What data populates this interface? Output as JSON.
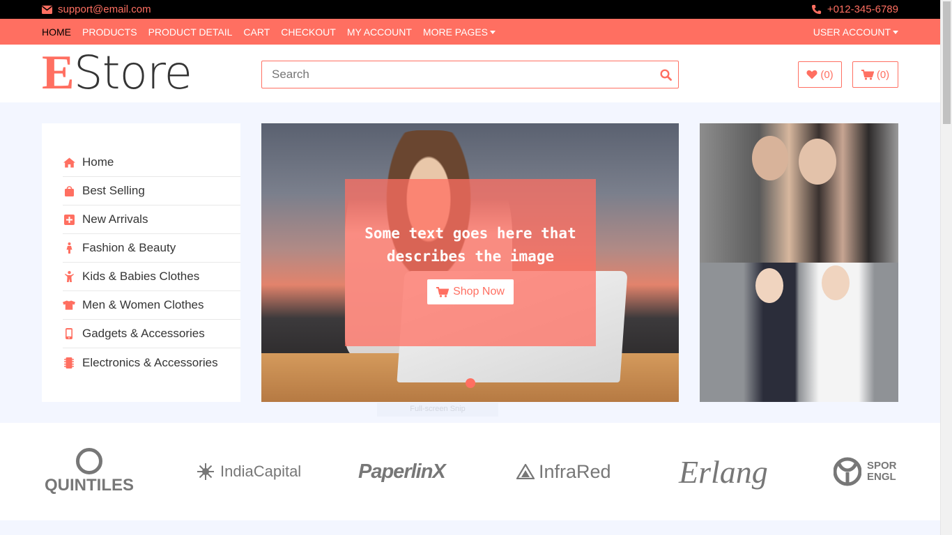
{
  "topbar": {
    "email": "support@email.com",
    "phone": "+012-345-6789"
  },
  "nav": {
    "links": [
      "HOME",
      "PRODUCTS",
      "PRODUCT DETAIL",
      "CART",
      "CHECKOUT",
      "MY ACCOUNT"
    ],
    "more": "MORE PAGES",
    "account": "USER ACCOUNT"
  },
  "header": {
    "logo_first": "E",
    "logo_rest": "Store",
    "search_placeholder": "Search",
    "wishlist_count": "(0)",
    "cart_count": "(0)"
  },
  "sidebar": {
    "items": [
      {
        "label": "Home",
        "icon": "home-icon"
      },
      {
        "label": "Best Selling",
        "icon": "shopping-bag-icon"
      },
      {
        "label": "New Arrivals",
        "icon": "plus-square-icon"
      },
      {
        "label": "Fashion & Beauty",
        "icon": "female-icon"
      },
      {
        "label": "Kids & Babies Clothes",
        "icon": "child-icon"
      },
      {
        "label": "Men & Women Clothes",
        "icon": "tshirt-icon"
      },
      {
        "label": "Gadgets & Accessories",
        "icon": "mobile-icon"
      },
      {
        "label": "Electronics & Accessories",
        "icon": "microchip-icon"
      }
    ]
  },
  "slider": {
    "caption": "Some text goes here that describes the image",
    "button": "Shop Now"
  },
  "snip_label": "Full-screen Snip",
  "brands": {
    "quintiles": "QUINTILES",
    "indiacapital": "IndiaCapital",
    "paperlinx": "PaperlinX",
    "infrared": "InfraRed",
    "erlang": "Erlang",
    "sport_line1": "SPOR",
    "sport_line2": "ENGL"
  },
  "colors": {
    "accent": "#ff6f61",
    "topbar": "#000000",
    "page_bg": "#f3f6ff"
  }
}
